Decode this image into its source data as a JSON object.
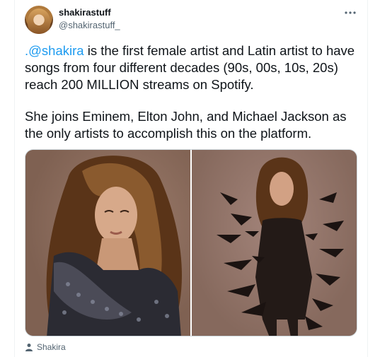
{
  "tweet": {
    "display_name": "shakirastuff",
    "handle": "@shakirastuff_",
    "more_icon": "more-horizontal-icon",
    "text": {
      "mention": ".@shakira",
      "paragraph1_rest": " is the first female artist and Latin artist to have songs from four different decades (90s, 00s, 10s, 20s) reach 200 MILLION streams on Spotify.",
      "paragraph2": "She joins Eminem, Elton John, and Michael Jackson as the only artists to accomplish this on the platform."
    },
    "media": {
      "photos": [
        {
          "icon": "photo-shakira-portrait"
        },
        {
          "icon": "photo-shakira-feathers"
        }
      ]
    },
    "tagged_person": {
      "icon": "person-icon",
      "name": "Shakira"
    }
  },
  "colors": {
    "accent": "#1d9bf0",
    "text": "#0f1419",
    "secondary": "#536471"
  }
}
